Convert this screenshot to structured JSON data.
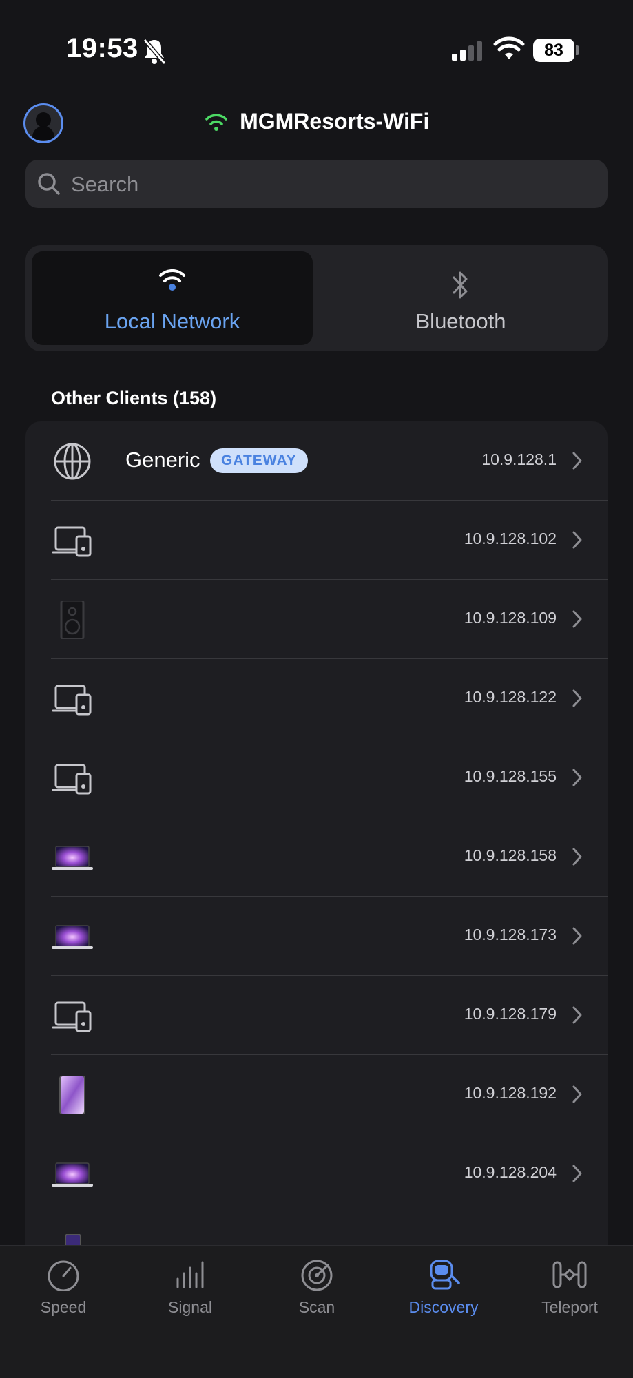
{
  "status_bar": {
    "time": "19:53",
    "battery": "83"
  },
  "header": {
    "network_name": "MGMResorts-WiFi"
  },
  "search": {
    "placeholder": "Search"
  },
  "segments": [
    {
      "label": "Local Network",
      "icon": "wifi-icon",
      "active": true
    },
    {
      "label": "Bluetooth",
      "icon": "bluetooth-icon",
      "active": false
    }
  ],
  "section": {
    "title": "Other Clients (158)"
  },
  "clients": [
    {
      "name": "Generic",
      "badge": "GATEWAY",
      "ip": "10.9.128.1",
      "icon": "globe-icon"
    },
    {
      "name": "",
      "ip": "10.9.128.102",
      "icon": "devices-icon"
    },
    {
      "name": "",
      "ip": "10.9.128.109",
      "icon": "speaker-icon"
    },
    {
      "name": "",
      "ip": "10.9.128.122",
      "icon": "devices-icon"
    },
    {
      "name": "",
      "ip": "10.9.128.155",
      "icon": "devices-icon"
    },
    {
      "name": "",
      "ip": "10.9.128.158",
      "icon": "laptop-icon"
    },
    {
      "name": "",
      "ip": "10.9.128.173",
      "icon": "laptop-icon"
    },
    {
      "name": "",
      "ip": "10.9.128.179",
      "icon": "devices-icon"
    },
    {
      "name": "",
      "ip": "10.9.128.192",
      "icon": "tablet-icon"
    },
    {
      "name": "",
      "ip": "10.9.128.204",
      "icon": "laptop-icon"
    }
  ],
  "tabs": [
    {
      "label": "Speed",
      "icon": "speedometer-icon"
    },
    {
      "label": "Signal",
      "icon": "signal-bars-icon"
    },
    {
      "label": "Scan",
      "icon": "radar-icon"
    },
    {
      "label": "Discovery",
      "icon": "discovery-icon",
      "active": true
    },
    {
      "label": "Teleport",
      "icon": "teleport-icon"
    }
  ],
  "colors": {
    "accent": "#5b8def",
    "wifi_green": "#4cd964",
    "badge_bg": "#cfe0fb"
  }
}
